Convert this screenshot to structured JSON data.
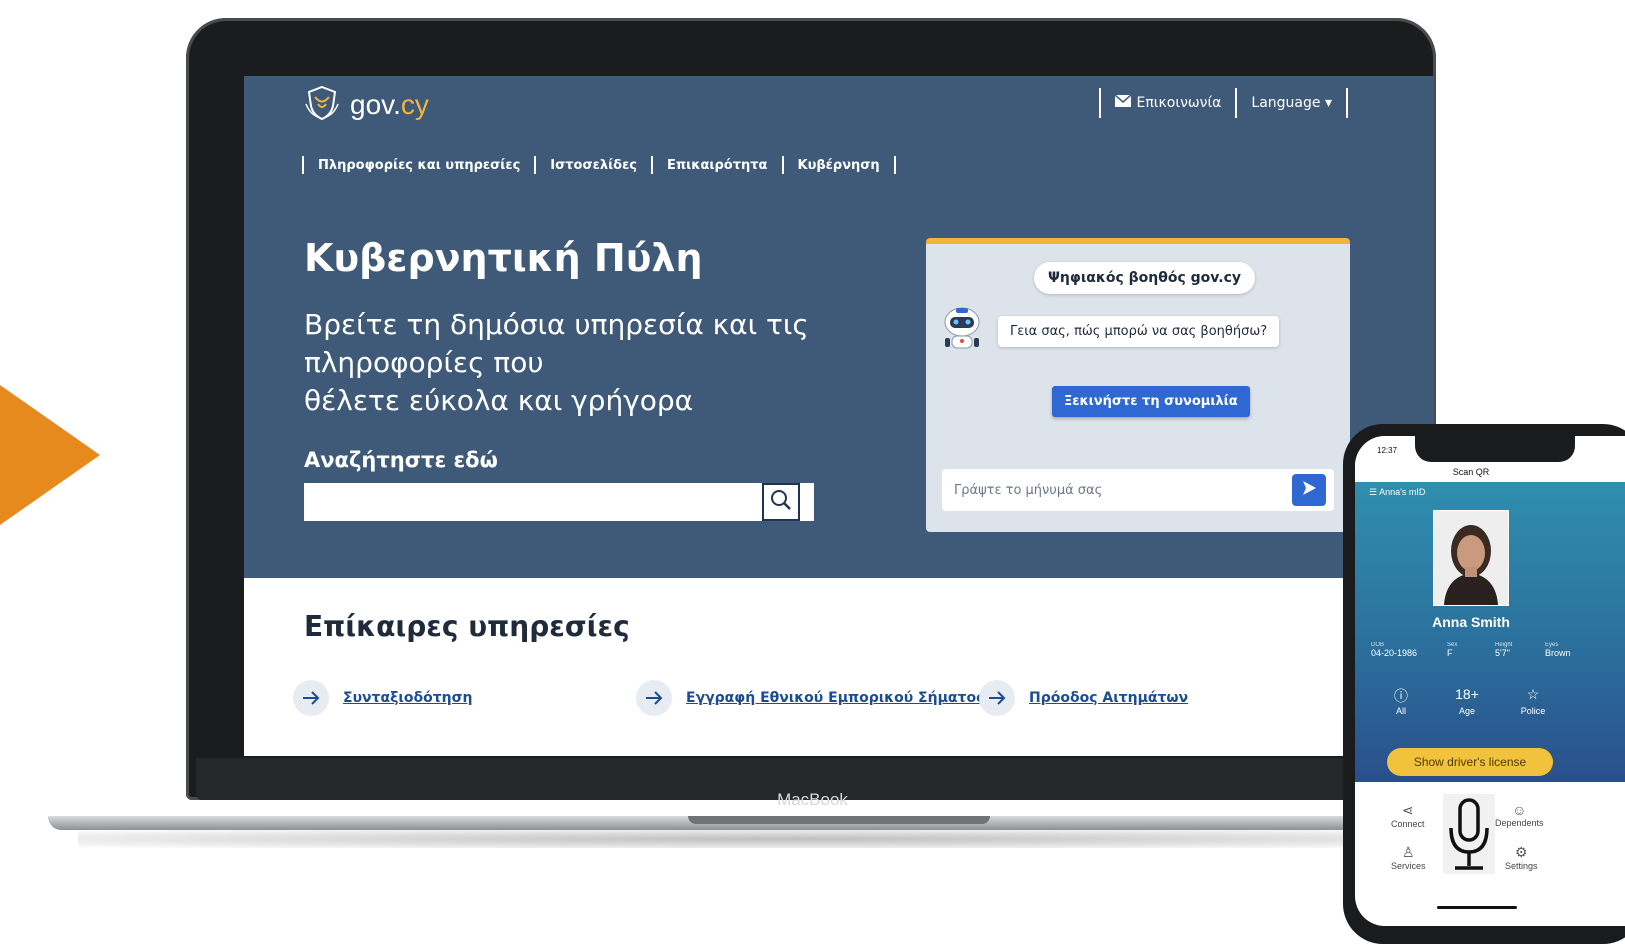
{
  "laptop": {
    "brand_label": "MacBook"
  },
  "site": {
    "logo": {
      "name": "gov.",
      "suffix": "cy"
    },
    "topbar": {
      "contact": "Επικοινωνία",
      "language": "Language ▾"
    },
    "nav": [
      "Πληροφορίες και υπηρεσίες",
      "Ιστοσελίδες",
      "Επικαιρότητα",
      "Κυβέρνηση"
    ],
    "hero": {
      "title": "Κυβερνητική Πύλη",
      "subtitle_line1": "Βρείτε τη δημόσια υπηρεσία και τις",
      "subtitle_line2": "πληροφορίες που",
      "subtitle_line3": "θέλετε εύκολα και γρήγορα"
    },
    "search": {
      "label": "Αναζήτηστε εδώ",
      "placeholder": ""
    },
    "chat": {
      "title": "Ψηφιακός βοηθός gov.cy",
      "greeting": "Γεια σας, πώς μπορώ να σας βοηθήσω?",
      "start_button": "Ξεκινήστε τη συνομιλία",
      "input_placeholder": "Γράψτε το μήνυμά σας"
    },
    "services": {
      "title": "Επίκαιρες υπηρεσίες",
      "items": [
        "Συνταξιοδότηση",
        "Εγγραφή Εθνικού Εμπορικού Σήματος",
        "Πρόοδος Αιτημάτων"
      ]
    }
  },
  "phone": {
    "time": "12:37",
    "header": "Scan QR",
    "menu": "Anna's mID",
    "name": "Anna Smith",
    "fields": [
      {
        "label": "DOB",
        "value": "04-20-1986"
      },
      {
        "label": "Sex",
        "value": "F"
      },
      {
        "label": "Height",
        "value": "5'7\""
      },
      {
        "label": "Eyes",
        "value": "Brown"
      }
    ],
    "icons": [
      {
        "glyph": "ⓘ",
        "label": "All"
      },
      {
        "glyph": "18+",
        "label": "Age"
      },
      {
        "glyph": "☆",
        "label": "Police"
      }
    ],
    "license_button": "Show driver's license",
    "bottom": {
      "connect": "Connect",
      "dependents": "Dependents",
      "services": "Services",
      "settings": "Settings"
    }
  },
  "colors": {
    "accent": "#e78a1e",
    "portal_blue": "#3e5a78",
    "link": "#1d4c91",
    "gov_yellow": "#f2b33d"
  }
}
